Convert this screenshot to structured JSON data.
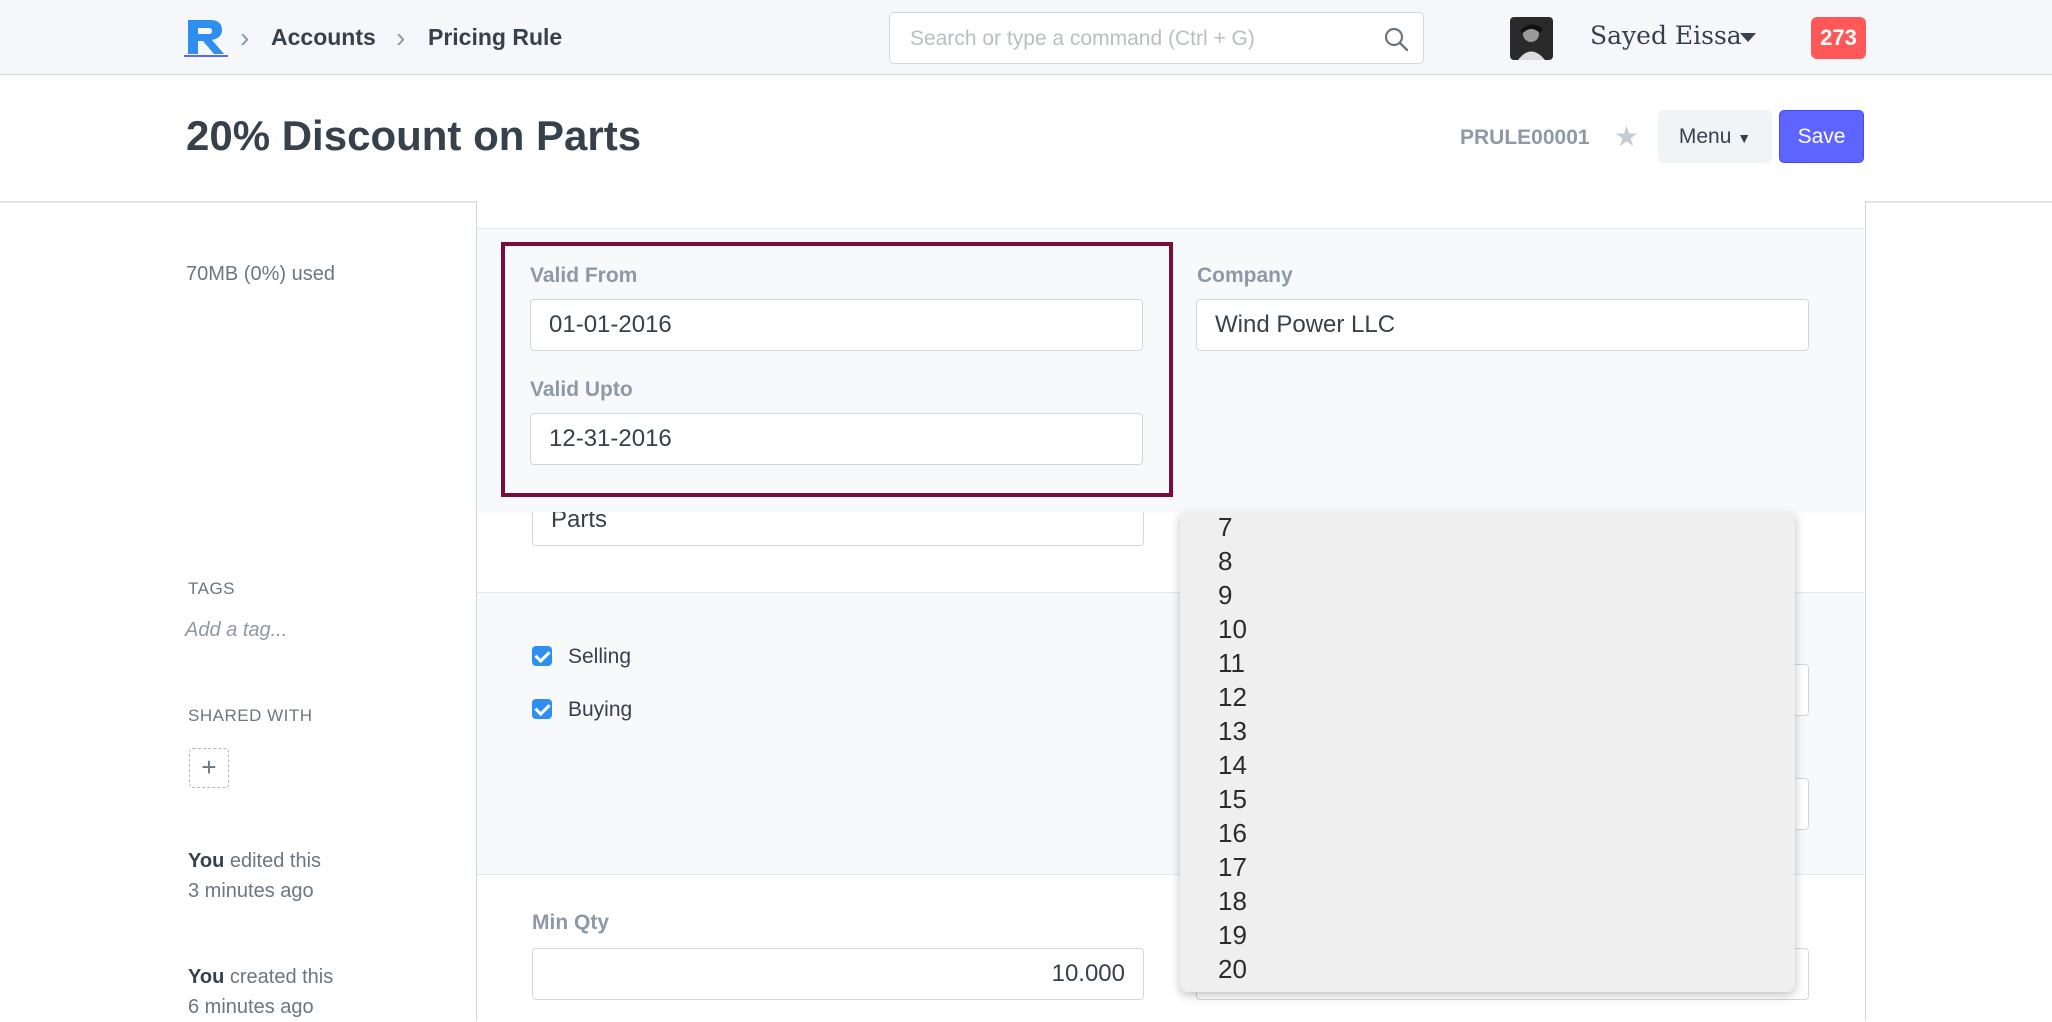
{
  "navbar": {
    "breadcrumbs": [
      "Accounts",
      "Pricing Rule"
    ],
    "search_placeholder": "Search or type a command (Ctrl + G)",
    "user_name": "Sayed Eissa",
    "notification_count": "273"
  },
  "page": {
    "title": "20% Discount on Parts",
    "doc_id": "PRULE00001",
    "menu_label": "Menu",
    "save_label": "Save"
  },
  "sidebar": {
    "storage_used": "70MB (0%) used",
    "tags_heading": "TAGS",
    "add_tag": "Add a tag...",
    "shared_heading": "SHARED WITH",
    "activity": [
      {
        "who": "You",
        "action": "edited this",
        "when": "3 minutes ago"
      },
      {
        "who": "You",
        "action": "created this",
        "when": "6 minutes ago"
      }
    ]
  },
  "form": {
    "valid_from_label": "Valid From",
    "valid_from_value": "01-01-2016",
    "valid_upto_label": "Valid Upto",
    "valid_upto_value": "12-31-2016",
    "company_label": "Company",
    "company_value": "Wind Power LLC",
    "apply_on_value": "Parts",
    "selling_label": "Selling",
    "buying_label": "Buying",
    "min_qty_label": "Min Qty",
    "min_qty_value": "10.000"
  },
  "dropdown": {
    "items": [
      "7",
      "8",
      "9",
      "10",
      "11",
      "12",
      "13",
      "14",
      "15",
      "16",
      "17",
      "18",
      "19",
      "20"
    ]
  },
  "colors": {
    "primary": "#5e64ff",
    "badge": "#ff5858",
    "highlight_border": "#7a0c3c",
    "checkbox": "#2f8ff0"
  }
}
